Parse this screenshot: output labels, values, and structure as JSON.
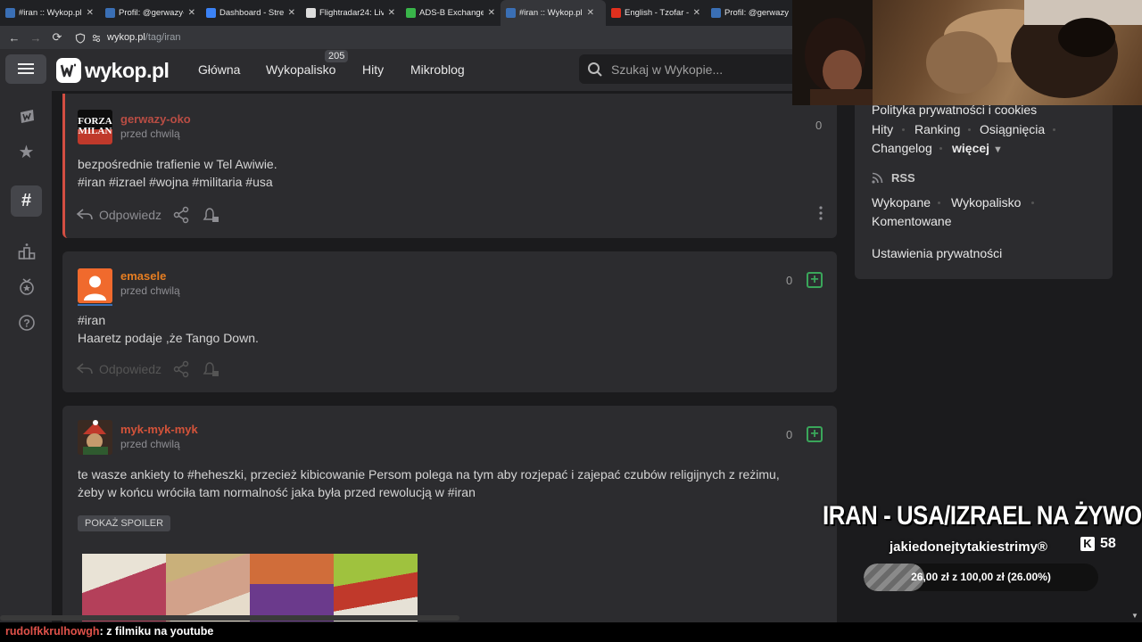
{
  "browser": {
    "tabs": [
      {
        "title": "#iran :: Wykop.pl",
        "color": "#3a6fb5",
        "active": false
      },
      {
        "title": "Profil: @gerwazy-",
        "color": "#3a6fb5",
        "active": false
      },
      {
        "title": "Dashboard - Stre",
        "color": "#3b82f6",
        "active": false
      },
      {
        "title": "Flightradar24: Liv",
        "color": "#dddddd",
        "active": false
      },
      {
        "title": "ADS-B Exchange",
        "color": "#39b54a",
        "active": false
      },
      {
        "title": "#iran :: Wykop.pl",
        "color": "#3a6fb5",
        "active": true
      },
      {
        "title": "English - Tzofar -",
        "color": "#e0301e",
        "active": false
      },
      {
        "title": "Profil: @gerwazy",
        "color": "#3a6fb5",
        "active": false
      }
    ],
    "url_host": "wykop.pl",
    "url_path": "/tag/iran"
  },
  "header": {
    "logo_text": "wykop.pl",
    "nav": {
      "home": "Główna",
      "wykopalisko": "Wykopalisko",
      "wykopalisko_count": "205",
      "hity": "Hity",
      "mikroblog": "Mikroblog"
    },
    "search_placeholder": "Szukaj w Wykopie..."
  },
  "posts": [
    {
      "author": "gerwazy-oko",
      "time": "przed chwilą",
      "votes": "0",
      "line1": "bezpośrednie trafienie w Tel Awiwie.",
      "line2": "#iran #izrael #wojna #militaria #usa",
      "reply": "Odpowiedz",
      "avatar_text_1": "FORZA",
      "avatar_text_2": "MILAN"
    },
    {
      "author": "emasele",
      "time": "przed chwilą",
      "votes": "0",
      "line1": "#iran",
      "line2": "Haaretz podaje ,że Tango Down.",
      "reply": "Odpowiedz"
    },
    {
      "author": "myk-myk-myk",
      "time": "przed chwilą",
      "votes": "0",
      "line1_pre": "te wasze ankiety to ",
      "line1_tag": "#heheszki",
      "line1_post": ", przecież kibicowanie Persom polega na tym aby rozjepać i zajepać czubów religijnych z reżimu,",
      "line2_pre": "żeby w końcu wróciła tam normalność jaka była przed rewolucją w ",
      "line2_tag": "#iran",
      "spoiler": "POKAŻ SPOILER"
    }
  ],
  "sidebar": {
    "privacy": "Polityka prywatności i cookies",
    "hity": "Hity",
    "ranking": "Ranking",
    "osiagniecia": "Osiągnięcia",
    "changelog": "Changelog",
    "wiecej": "więcej",
    "rss": "RSS",
    "wykopane": "Wykopane",
    "wykopalisko": "Wykopalisko",
    "komentowane": "Komentowane",
    "privacy_settings": "Ustawienia prywatności"
  },
  "stream": {
    "title": "IRAN - USA/IZRAEL NA ŻYWO",
    "channel": "jakiedonejtytakiestrimy®",
    "kick_count": "58",
    "goal_label": "26,00 zł z 100,00 zł (26.00%)",
    "goal_progress": 0.26,
    "chat_user": "rudolfkkrulhowgh",
    "chat_message": ": z filmiku na youtube"
  }
}
